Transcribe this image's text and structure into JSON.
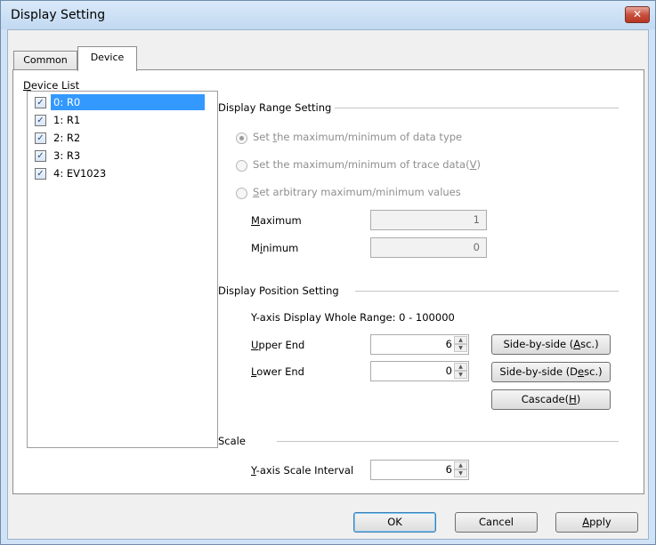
{
  "window": {
    "title": "Display Setting",
    "close_glyph": "✕"
  },
  "tabs": [
    {
      "label": "Common"
    },
    {
      "label": "Device"
    }
  ],
  "device_list": {
    "label_first": "D",
    "label_rest": "evice List",
    "items": [
      {
        "label": "0: R0",
        "checked": true,
        "selected": true
      },
      {
        "label": "1: R1",
        "checked": true,
        "selected": false
      },
      {
        "label": "2: R2",
        "checked": true,
        "selected": false
      },
      {
        "label": "3: R3",
        "checked": true,
        "selected": false
      },
      {
        "label": "4: EV1023",
        "checked": true,
        "selected": false
      }
    ]
  },
  "display_range": {
    "heading": "Display Range Setting",
    "option_datatype": {
      "pre": "Set ",
      "acc": "t",
      "post": "he maximum/minimum of data type"
    },
    "option_trace": {
      "text": "Set the maximum/minimum of trace data(",
      "acc": "V",
      "close": ")"
    },
    "option_arbitrary": {
      "acc": "S",
      "post": "et arbitrary maximum/minimum values"
    },
    "maximum": {
      "acc": "M",
      "rest": "aximum",
      "value": "1"
    },
    "minimum": {
      "pre": "M",
      "acc": "i",
      "post": "nimum",
      "value": "0"
    }
  },
  "display_position": {
    "heading": "Display Position Setting",
    "whole_range": "Y-axis Display Whole Range: 0 - 100000",
    "upper": {
      "acc": "U",
      "rest": "pper End",
      "value": "6"
    },
    "lower": {
      "acc": "L",
      "rest": "ower End",
      "value": "0"
    },
    "btn_asc": {
      "pre": "Side-by-side (",
      "acc": "A",
      "post": "sc.)"
    },
    "btn_desc": {
      "pre": "Side-by-side (D",
      "acc": "e",
      "post": "sc.)"
    },
    "btn_cascade": {
      "pre": "Cascade(",
      "acc": "H",
      "post": ")"
    }
  },
  "scale": {
    "heading": "Scale",
    "interval": {
      "acc": "Y",
      "rest": "-axis Scale Interval",
      "value": "6"
    }
  },
  "footer": {
    "ok": "OK",
    "cancel": "Cancel",
    "apply_acc": "A",
    "apply_rest": "pply"
  },
  "icons": {
    "spin_up": "▲",
    "spin_down": "▼",
    "check": "✓"
  }
}
